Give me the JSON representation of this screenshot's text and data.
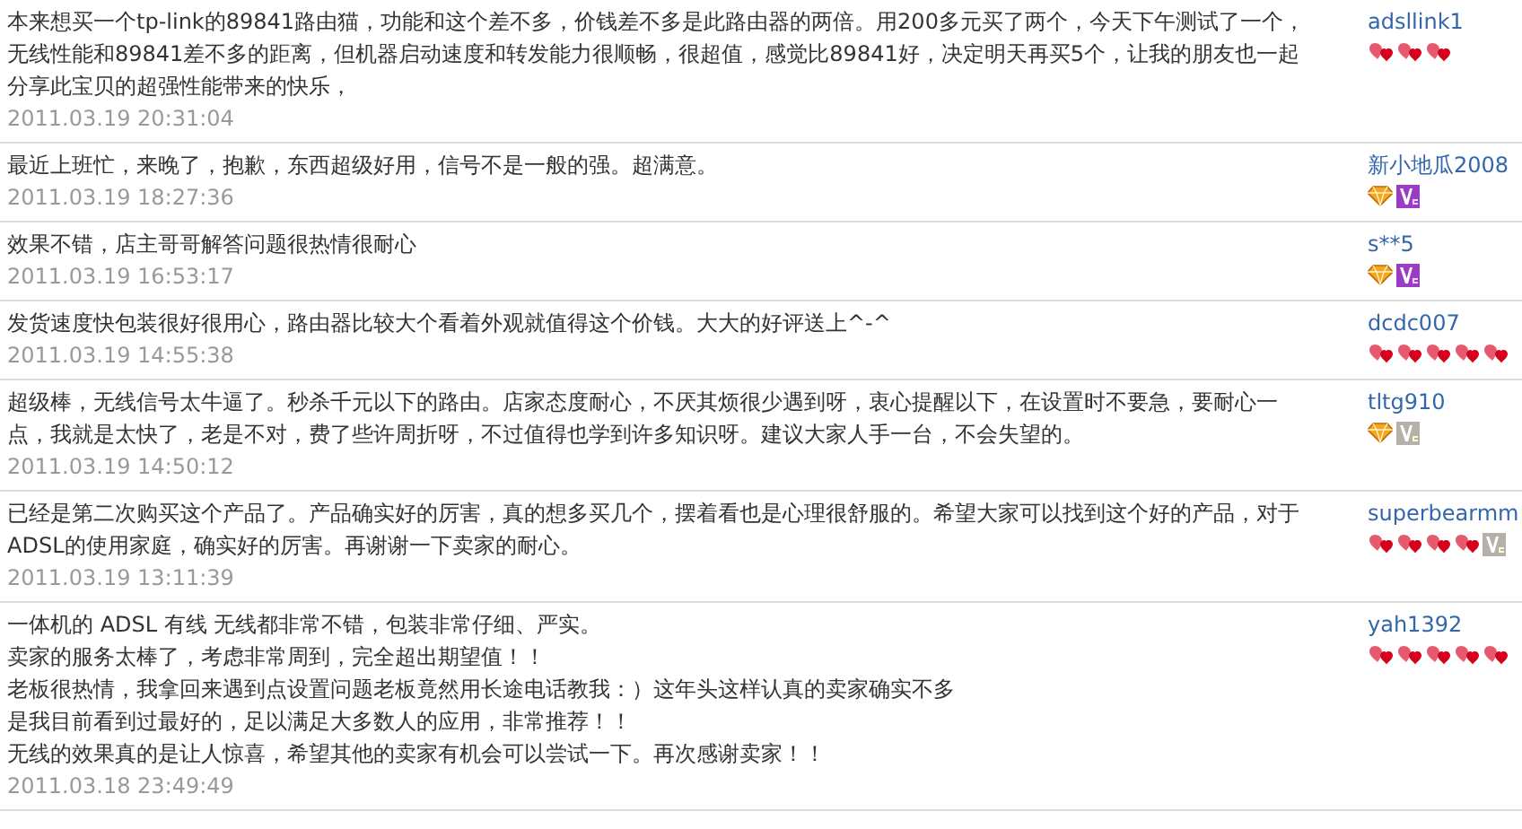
{
  "reviews": [
    {
      "lines": [
        "本来想买一个tp-link的89841路由猫，功能和这个差不多，价钱差不多是此路由器的两倍。用200多元买了两个，今天下午测试了一个，",
        "无线性能和89841差不多的距离，但机器启动速度和转发能力很顺畅，很超值，感觉比89841好，决定明天再买5个，让我的朋友也一起",
        "分享此宝贝的超强性能带来的快乐，"
      ],
      "date": "2011.03.19 20:31:04",
      "user": "adsllink1",
      "badges": [
        {
          "kind": "heart"
        },
        {
          "kind": "heart"
        },
        {
          "kind": "heart"
        }
      ]
    },
    {
      "lines": [
        "最近上班忙，来晚了，抱歉，东西超级好用，信号不是一般的强。超满意。"
      ],
      "date": "2011.03.19 18:27:36",
      "user": "新小地瓜2008",
      "badges": [
        {
          "kind": "diamond"
        },
        {
          "kind": "vip"
        }
      ]
    },
    {
      "lines": [
        "效果不错，店主哥哥解答问题很热情很耐心"
      ],
      "date": "2011.03.19 16:53:17",
      "user": "s**5",
      "badges": [
        {
          "kind": "diamond"
        },
        {
          "kind": "vip"
        }
      ]
    },
    {
      "lines": [
        "发货速度快包装很好很用心，路由器比较大个看着外观就值得这个价钱。大大的好评送上^-^"
      ],
      "date": "2011.03.19 14:55:38",
      "user": "dcdc007",
      "badges": [
        {
          "kind": "heart"
        },
        {
          "kind": "heart"
        },
        {
          "kind": "heart"
        },
        {
          "kind": "heart"
        },
        {
          "kind": "heart"
        }
      ]
    },
    {
      "lines": [
        "超级棒，无线信号太牛逼了。秒杀千元以下的路由。店家态度耐心，不厌其烦很少遇到呀，衷心提醒以下，在设置时不要急，要耐心一",
        "点，我就是太快了，老是不对，费了些许周折呀，不过值得也学到许多知识呀。建议大家人手一台，不会失望的。"
      ],
      "date": "2011.03.19 14:50:12",
      "user": "tltg910",
      "badges": [
        {
          "kind": "diamond"
        },
        {
          "kind": "vip-grey"
        }
      ]
    },
    {
      "lines": [
        "已经是第二次购买这个产品了。产品确实好的厉害，真的想多买几个，摆着看也是心理很舒服的。希望大家可以找到这个好的产品，对于",
        "ADSL的使用家庭，确实好的厉害。再谢谢一下卖家的耐心。"
      ],
      "date": "2011.03.19 13:11:39",
      "user": "superbearmm",
      "badges": [
        {
          "kind": "heart"
        },
        {
          "kind": "heart"
        },
        {
          "kind": "heart"
        },
        {
          "kind": "heart"
        },
        {
          "kind": "vip-grey"
        }
      ]
    },
    {
      "lines": [
        "一体机的 ADSL 有线 无线都非常不错，包装非常仔细、严实。",
        "卖家的服务太棒了，考虑非常周到，完全超出期望值！！",
        "老板很热情，我拿回来遇到点设置问题老板竟然用长途电话教我：）这年头这样认真的卖家确实不多",
        "是我目前看到过最好的，足以满足大多数人的应用，非常推荐！！",
        "无线的效果真的是让人惊喜，希望其他的卖家有机会可以尝试一下。再次感谢卖家！！"
      ],
      "date": "2011.03.18 23:49:49",
      "user": "yah1392",
      "badges": [
        {
          "kind": "heart"
        },
        {
          "kind": "heart"
        },
        {
          "kind": "heart"
        },
        {
          "kind": "heart"
        },
        {
          "kind": "heart"
        }
      ]
    }
  ]
}
